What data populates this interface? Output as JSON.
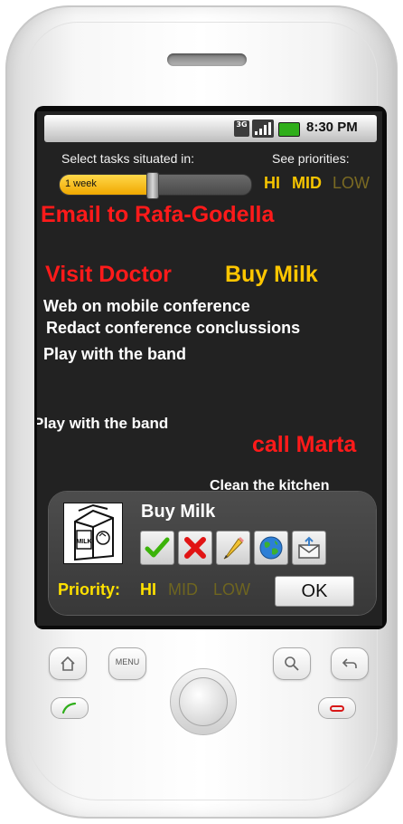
{
  "status_bar": {
    "network": "3G",
    "time": "8:30 PM"
  },
  "filters": {
    "select_label": "Select tasks situated in:",
    "slider_value_label": "1 week",
    "slider_fraction": 0.48,
    "priorities_label": "See priorities:",
    "priority_hi": "HI",
    "priority_mid": "MID",
    "priority_low": "LOW"
  },
  "tasks": [
    {
      "label": "Email to Rafa-Godella",
      "color": "#ff1a1a"
    },
    {
      "label": "Visit Doctor",
      "color": "#ff1a1a"
    },
    {
      "label": "Buy Milk",
      "color": "#ffc600"
    },
    {
      "label": "Web on mobile conference",
      "color": "#ffffff"
    },
    {
      "label": "Redact conference conclussions",
      "color": "#ffffff"
    },
    {
      "label": "Play with the band",
      "color": "#ffffff"
    },
    {
      "label": "Play with the band",
      "color": "#ffffff"
    },
    {
      "label": "call Marta",
      "color": "#ff1a1a"
    },
    {
      "label": "Clean the kitchen",
      "color": "#ffffff"
    }
  ],
  "popup": {
    "title": "Buy Milk",
    "image_label": "MILK",
    "actions": [
      {
        "icon": "check-icon"
      },
      {
        "icon": "delete-icon"
      },
      {
        "icon": "pencil-icon"
      },
      {
        "icon": "globe-icon"
      },
      {
        "icon": "mail-icon"
      }
    ],
    "priority_label": "Priority:",
    "priority_hi": "HI",
    "priority_mid": "MID",
    "priority_low": "LOW",
    "ok_label": "OK"
  },
  "hardware": {
    "menu_label": "MENU"
  },
  "colors": {
    "high_priority": "#ff1a1a",
    "mid_priority": "#ffc600",
    "low_priority": "#ffffff",
    "accent_yellow": "#ffe100"
  }
}
